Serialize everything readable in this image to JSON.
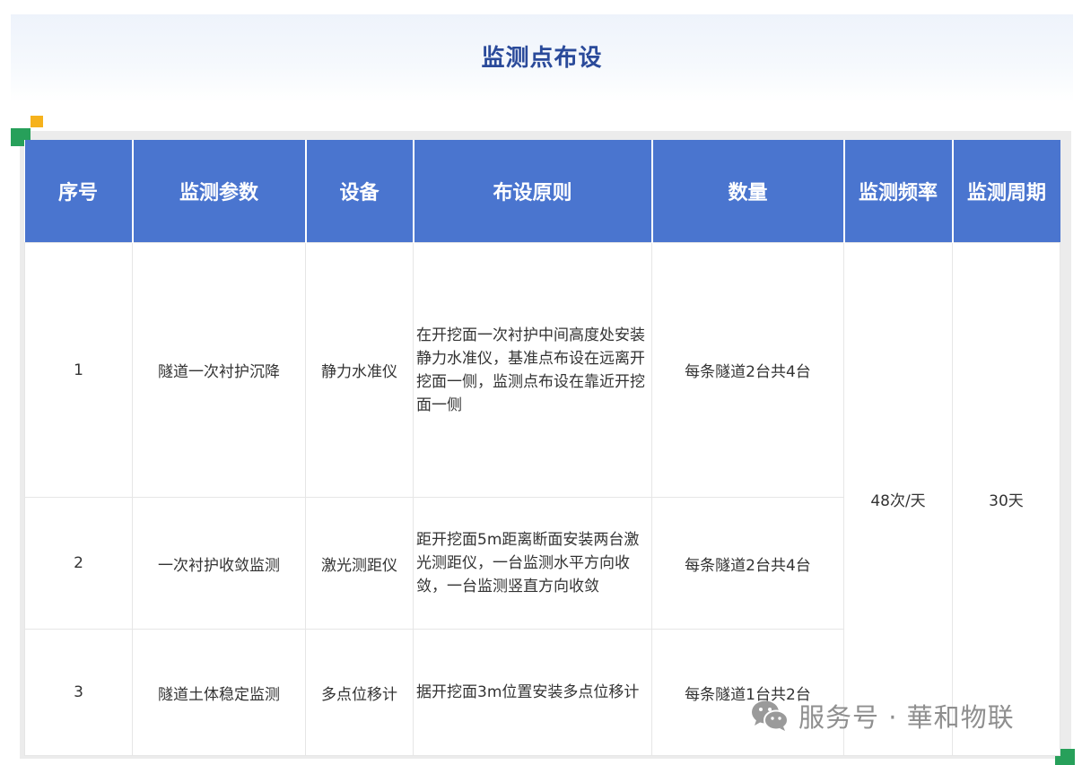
{
  "title": "监测点布设",
  "table": {
    "headers": [
      "序号",
      "监测参数",
      "设备",
      "布设原则",
      "数量",
      "监测频率",
      "监测周期"
    ],
    "rows": [
      {
        "no": "1",
        "param": "隧道一次衬护沉降",
        "device": "静力水准仪",
        "principle": "在开挖面一次衬护中间高度处安装静力水准仪，基准点布设在远离开挖面一侧，监测点布设在靠近开挖面一侧",
        "quantity": "每条隧道2台共4台"
      },
      {
        "no": "2",
        "param": "一次衬护收敛监测",
        "device": "激光测距仪",
        "principle": "距开挖面5m距离断面安装两台激光测距仪，一台监测水平方向收敛，一台监测竖直方向收敛",
        "quantity": "每条隧道2台共4台"
      },
      {
        "no": "3",
        "param": "隧道土体稳定监测",
        "device": "多点位移计",
        "principle": "据开挖面3m位置安装多点位移计",
        "quantity": "每条隧道1台共2台"
      }
    ],
    "frequency": "48次/天",
    "period": "30天"
  },
  "watermark": {
    "text": "服务号 · 華和物联",
    "icon": "wechat-icon"
  },
  "colors": {
    "header_bg": "#4a75cf",
    "title": "#2a4a9a",
    "accent_orange": "#f6b21c",
    "accent_green": "#27a05a"
  }
}
